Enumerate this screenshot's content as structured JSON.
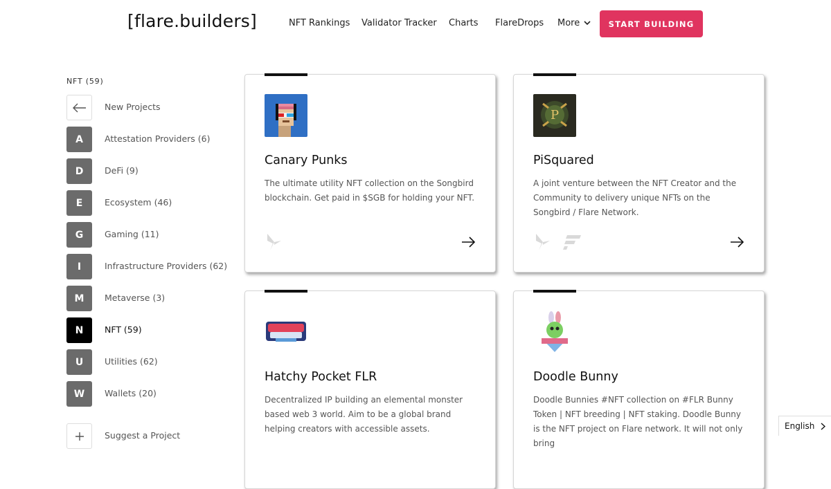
{
  "header": {
    "logo": "[flare.builders]",
    "nav": [
      "NFT Rankings",
      "Validator Tracker",
      "Charts",
      "FlareDrops",
      "More"
    ],
    "cta": "START BUILDING"
  },
  "sidebar": {
    "title": "NFT (59)",
    "back_label": "New Projects",
    "items": [
      {
        "letter": "A",
        "label": "Attestation Providers (6)"
      },
      {
        "letter": "D",
        "label": "DeFi (9)"
      },
      {
        "letter": "E",
        "label": "Ecosystem (46)"
      },
      {
        "letter": "G",
        "label": "Gaming (11)"
      },
      {
        "letter": "I",
        "label": "Infrastructure Providers (62)"
      },
      {
        "letter": "M",
        "label": "Metaverse (3)"
      },
      {
        "letter": "N",
        "label": "NFT (59)"
      },
      {
        "letter": "U",
        "label": "Utilities (62)"
      },
      {
        "letter": "W",
        "label": "Wallets (20)"
      }
    ],
    "bottom_label": "Suggest a Project",
    "bottom_icon": "plus-icon"
  },
  "cards": [
    {
      "title": "Canary Punks",
      "description": "The ultimate utility NFT collection on the Songbird blockchain. Get paid in $SGB for holding your NFT.",
      "image_icon": "pixel-punk-avatar",
      "chains": [
        "songbird-icon"
      ]
    },
    {
      "title": "PiSquared",
      "description": "A joint venture between the NFT Creator and the Community to delivery unique NFTs on the Songbird / Flare Network.",
      "image_icon": "pisquared-crest",
      "chains": [
        "songbird-icon",
        "flare-icon"
      ]
    },
    {
      "title": "Hatchy Pocket FLR",
      "description": "Decentralized IP building an elemental monster based web 3 world. Aim to be a global brand helping creators with accessible assets.",
      "image_icon": "hatchy-pocket-logo",
      "chains": []
    },
    {
      "title": "Doodle Bunny",
      "description": "Doodle Bunnies #NFT collection on #FLR Bunny Token | NFT breeding | NFT staking. Doodle Bunny is the NFT project on Flare network. It will not only bring",
      "image_icon": "doodle-bunny-logo",
      "chains": []
    }
  ],
  "language": "English",
  "colors": {
    "accent": "#e0345f",
    "active_box": "#000000",
    "inactive_box": "#6b6b6b"
  }
}
